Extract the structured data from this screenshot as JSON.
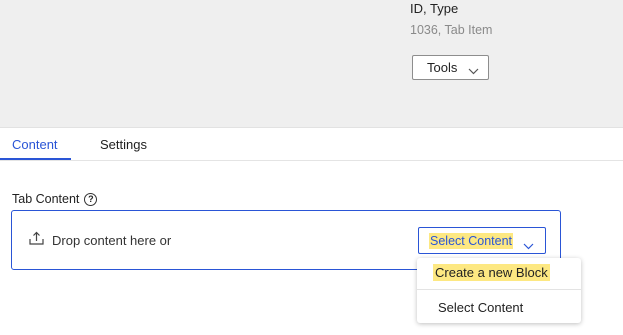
{
  "header": {
    "meta_label": "ID, Type",
    "meta_value": "1036, Tab Item",
    "tools_label": "Tools",
    "icons": {
      "tools_chevron": "chevron-down-icon"
    }
  },
  "tabs": [
    {
      "label": "Content",
      "active": true
    },
    {
      "label": "Settings",
      "active": false
    }
  ],
  "field": {
    "label": "Tab Content",
    "help_icon": "question-circle-icon",
    "help_glyph": "?"
  },
  "drop_zone": {
    "text": "Drop content here or",
    "upload_icon": "upload-icon",
    "select_label": "Select Content"
  },
  "dropdown": {
    "items": [
      {
        "label": "Create a new Block"
      },
      {
        "label": "Select Content"
      }
    ]
  },
  "colors": {
    "accent": "#2a55d6",
    "highlight": "#fde882",
    "header_bg": "#efefef"
  }
}
